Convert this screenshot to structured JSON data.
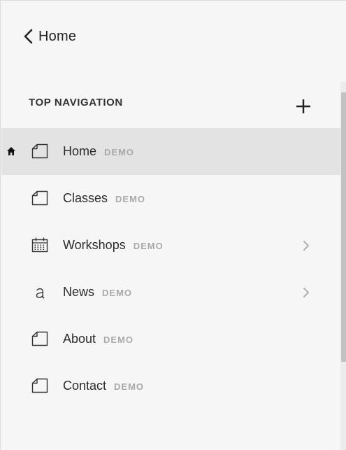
{
  "header": {
    "back_label": "Home",
    "back_icon": "chevron-left-icon"
  },
  "section": {
    "title": "TOP NAVIGATION",
    "add_icon": "plus-icon"
  },
  "nav_items": [
    {
      "label": "Home",
      "badge": "DEMO",
      "icon": "page-icon",
      "active": true,
      "is_homepage": true,
      "has_children": false
    },
    {
      "label": "Classes",
      "badge": "DEMO",
      "icon": "page-icon",
      "active": false,
      "has_children": false
    },
    {
      "label": "Workshops",
      "badge": "DEMO",
      "icon": "calendar-icon",
      "active": false,
      "has_children": true
    },
    {
      "label": "News",
      "badge": "DEMO",
      "icon": "blog-icon",
      "active": false,
      "has_children": true
    },
    {
      "label": "About",
      "badge": "DEMO",
      "icon": "page-icon",
      "active": false,
      "has_children": false
    },
    {
      "label": "Contact",
      "badge": "DEMO",
      "icon": "page-icon",
      "active": false,
      "has_children": false
    }
  ],
  "colors": {
    "background": "#f6f6f6",
    "active_row": "#e3e3e3",
    "badge_text": "#a9a9a9"
  }
}
